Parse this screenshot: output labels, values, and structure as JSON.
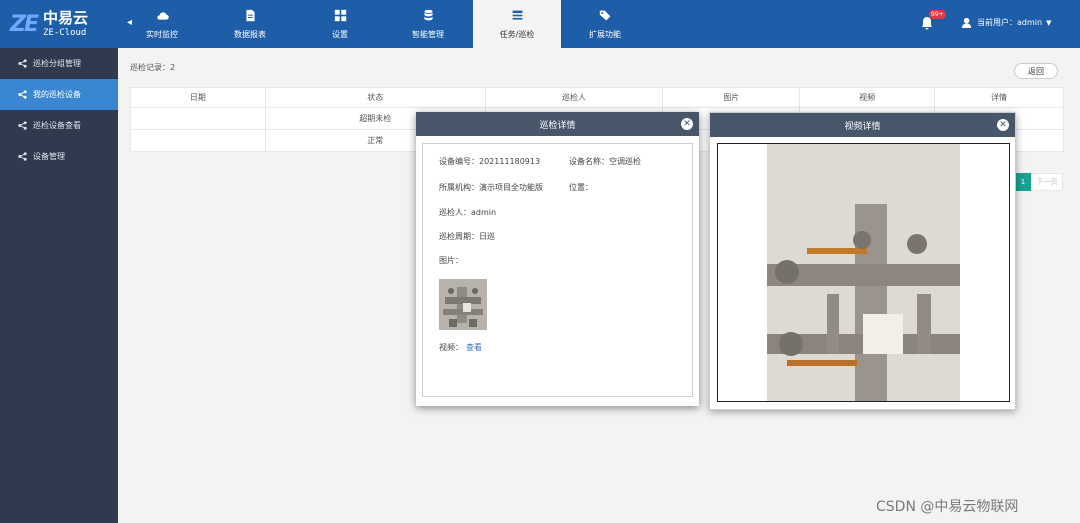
{
  "logo": {
    "name_cn": "中易云",
    "name_en": "ZE-Cloud"
  },
  "nav": {
    "tabs": [
      {
        "label": "实时监控",
        "icon": "cloud-icon"
      },
      {
        "label": "数据报表",
        "icon": "document-icon"
      },
      {
        "label": "设置",
        "icon": "grid-icon"
      },
      {
        "label": "智能管理",
        "icon": "database-icon"
      },
      {
        "label": "任务/巡检",
        "icon": "list-icon",
        "active": true
      },
      {
        "label": "扩展功能",
        "icon": "tags-icon"
      }
    ]
  },
  "header": {
    "badge": "99+",
    "user_label": "当前用户：admin"
  },
  "sidebar": {
    "items": [
      {
        "label": "巡检分组管理"
      },
      {
        "label": "我的巡检设备",
        "active": true
      },
      {
        "label": "巡检设备查看"
      },
      {
        "label": "设备管理"
      }
    ]
  },
  "main": {
    "record_count": "巡检记录：2",
    "back_label": "返回",
    "table": {
      "headers": [
        "日期",
        "状态",
        "巡检人",
        "图片",
        "视频",
        "详情"
      ],
      "rows": [
        {
          "status": "超期未检"
        },
        {
          "status": "正常"
        }
      ]
    },
    "pager": {
      "current": "1",
      "next": "下一页"
    }
  },
  "modal_detail": {
    "title": "巡检详情",
    "device_no": "设备编号：20211118091​3",
    "device_name": "设备名称：空调巡检",
    "org": "所属机构：演示项目全功能版",
    "location": "位置：",
    "inspector": "巡检人：admin",
    "cycle": "巡检周期：日巡",
    "image_label": "图片：",
    "video_label": "视频：",
    "video_link": "查看"
  },
  "modal_video": {
    "title": "视频详情"
  },
  "watermark": "CSDN @中易云物联网",
  "colors": {
    "topbar": "#1e5ea8",
    "sidebar": "#2f3a4e",
    "sidebar_active": "#3a86d1",
    "modal_header": "#48566a"
  }
}
